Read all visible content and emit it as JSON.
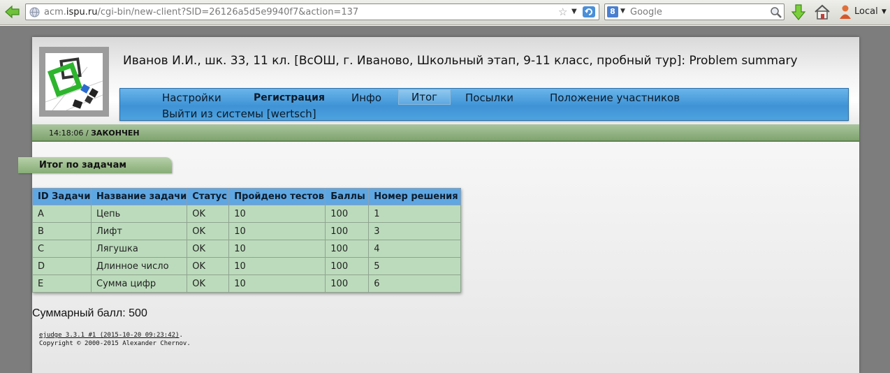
{
  "browser": {
    "url_prefix": "acm.",
    "url_domain": "ispu.ru",
    "url_rest": "/cgi-bin/new-client?SID=26126a5d5e9940f7&action=137",
    "search_placeholder": "Google",
    "search_engine_letter": "8",
    "profile_label": "Local"
  },
  "header": {
    "title": "Иванов И.И., шк. 33, 11 кл. [ВсОШ, г. Иваново, Школьный этап, 9-11 класс, пробный тур]: Problem summary"
  },
  "menu": {
    "items": [
      {
        "label": "Настройки"
      },
      {
        "label": "Регистрация"
      },
      {
        "label": "Инфо"
      },
      {
        "label": "Итог"
      },
      {
        "label": "Посылки"
      },
      {
        "label": "Положение участников"
      },
      {
        "label": "Выйти из системы [wertsch]"
      }
    ],
    "active_index": 3
  },
  "status": {
    "time": "14:18:06 / ",
    "state": "ЗАКОНЧЕН"
  },
  "section": {
    "title": "Итог по задачам"
  },
  "table": {
    "headers": [
      "ID Задачи",
      "Название задачи",
      "Статус",
      "Пройдено тестов",
      "Баллы",
      "Номер решения"
    ],
    "rows": [
      [
        "A",
        "Цепь",
        "OK",
        "10",
        "100",
        "1"
      ],
      [
        "B",
        "Лифт",
        "OK",
        "10",
        "100",
        "3"
      ],
      [
        "C",
        "Лягушка",
        "OK",
        "10",
        "100",
        "4"
      ],
      [
        "D",
        "Длинное число",
        "OK",
        "10",
        "100",
        "5"
      ],
      [
        "E",
        "Сумма цифр",
        "OK",
        "10",
        "100",
        "6"
      ]
    ]
  },
  "summary": {
    "total_label": "Суммарный балл: 500"
  },
  "footer": {
    "version_link": "ejudge 3.3.1 #1 (2015-10-20 09:23:42)",
    "version_suffix": ".",
    "copyright": "Copyright © 2000-2015 Alexander Chernov."
  },
  "colors": {
    "menu_blue": "#4da2de",
    "status_green": "#87ad75",
    "table_header": "#5fa7e3",
    "table_cell": "#bcdbbc"
  }
}
